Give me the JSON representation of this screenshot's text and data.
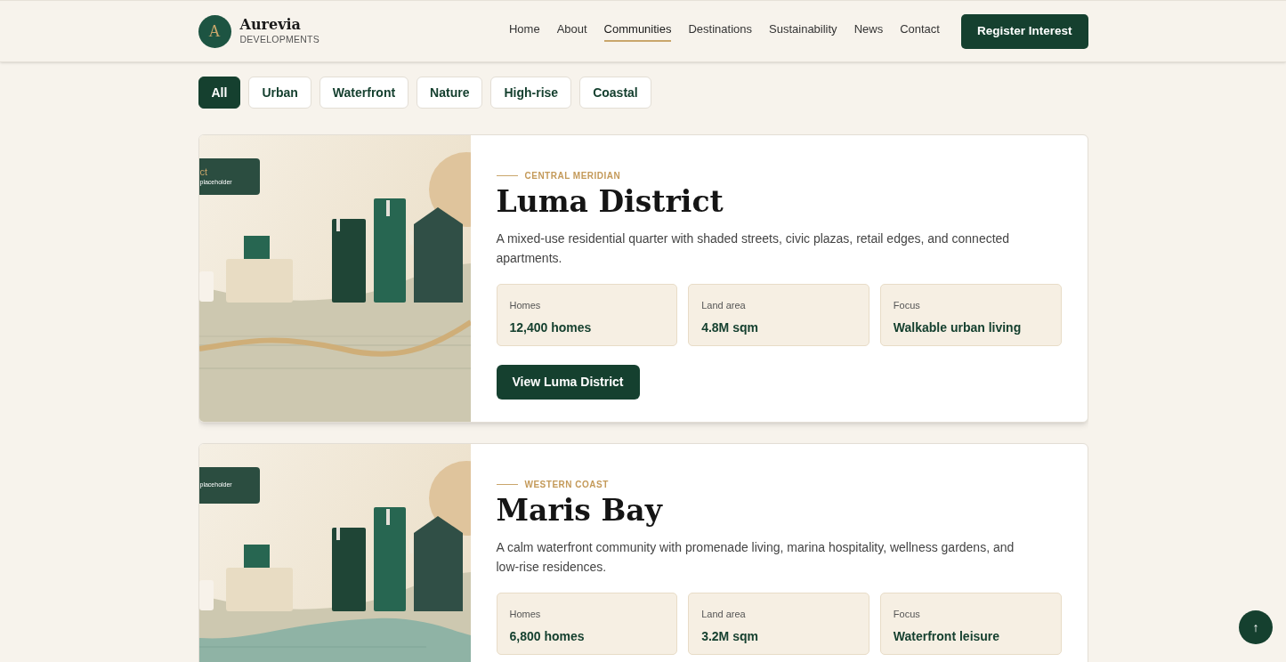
{
  "brand": {
    "mark": "A",
    "name": "Aurevia",
    "tagline": "DEVELOPMENTS"
  },
  "nav": [
    {
      "label": "Home",
      "selected": false
    },
    {
      "label": "About",
      "selected": false
    },
    {
      "label": "Communities",
      "selected": true
    },
    {
      "label": "Destinations",
      "selected": false
    },
    {
      "label": "Sustainability",
      "selected": false
    },
    {
      "label": "News",
      "selected": false
    },
    {
      "label": "Contact",
      "selected": false
    }
  ],
  "cta": "Register Interest",
  "filters": [
    {
      "label": "All",
      "selected": true
    },
    {
      "label": "Urban",
      "selected": false
    },
    {
      "label": "Waterfront",
      "selected": false
    },
    {
      "label": "Nature",
      "selected": false
    },
    {
      "label": "High-rise",
      "selected": false
    },
    {
      "label": "Coastal",
      "selected": false
    }
  ],
  "communities": [
    {
      "image": {
        "kind": "road",
        "label_title": "ct",
        "label_note": "placeholder"
      },
      "region": "CENTRAL MERIDIAN",
      "title": "Luma District",
      "description": "A mixed-use residential quarter with shaded streets, civic plazas, retail edges, and connected apartments.",
      "stats": [
        {
          "label": "Homes",
          "value": "12,400 homes"
        },
        {
          "label": "Land area",
          "value": "4.8M sqm"
        },
        {
          "label": "Focus",
          "value": "Walkable urban living"
        }
      ],
      "button": "View Luma District"
    },
    {
      "image": {
        "kind": "water",
        "label_note": "placeholder"
      },
      "region": "WESTERN COAST",
      "title": "Maris Bay",
      "description": "A calm waterfront community with promenade living, marina hospitality, wellness gardens, and low-rise residences.",
      "stats": [
        {
          "label": "Homes",
          "value": "6,800 homes"
        },
        {
          "label": "Land area",
          "value": "3.2M sqm"
        },
        {
          "label": "Focus",
          "value": "Waterfront leisure"
        }
      ]
    }
  ],
  "scroll_top": "↑"
}
